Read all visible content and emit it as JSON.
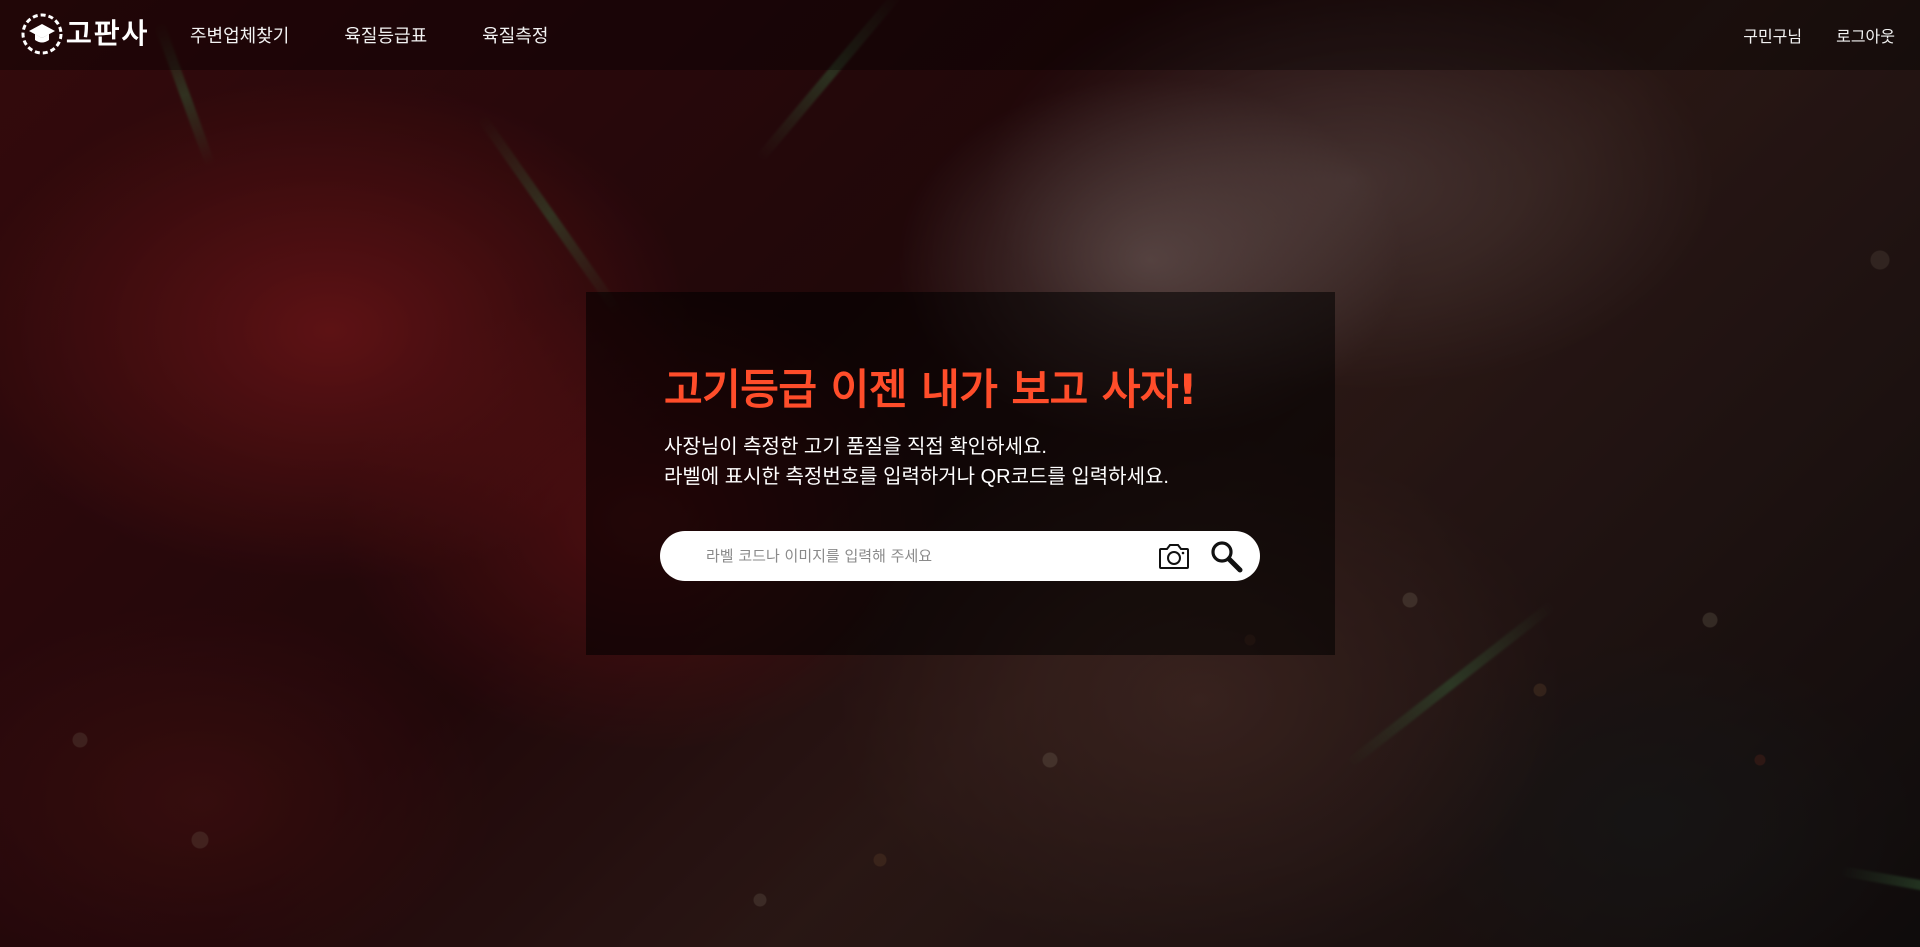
{
  "brand": {
    "name": "고판사",
    "logo_icon": "graduation-cap-icon"
  },
  "nav": {
    "items": [
      {
        "label": "주변업체찾기"
      },
      {
        "label": "육질등급표"
      },
      {
        "label": "육질측정"
      }
    ],
    "user_label": "구민구님",
    "logout_label": "로그아웃"
  },
  "hero": {
    "headline": "고기등급 이젠 내가 보고 사자!",
    "sub_line_1": "사장님이 측정한 고기 품질을 직접 확인하세요.",
    "sub_line_2": "라벨에 표시한 측정번호를 입력하거나 QR코드를 입력하세요."
  },
  "search": {
    "placeholder": "라벨 코드나 이미지를 입력해 주세요",
    "value": "",
    "camera_icon": "camera-icon",
    "search_icon": "search-icon"
  },
  "colors": {
    "accent": "#ff4d2a",
    "text": "#ffffff",
    "panel": "rgba(0,0,0,0.55)"
  }
}
